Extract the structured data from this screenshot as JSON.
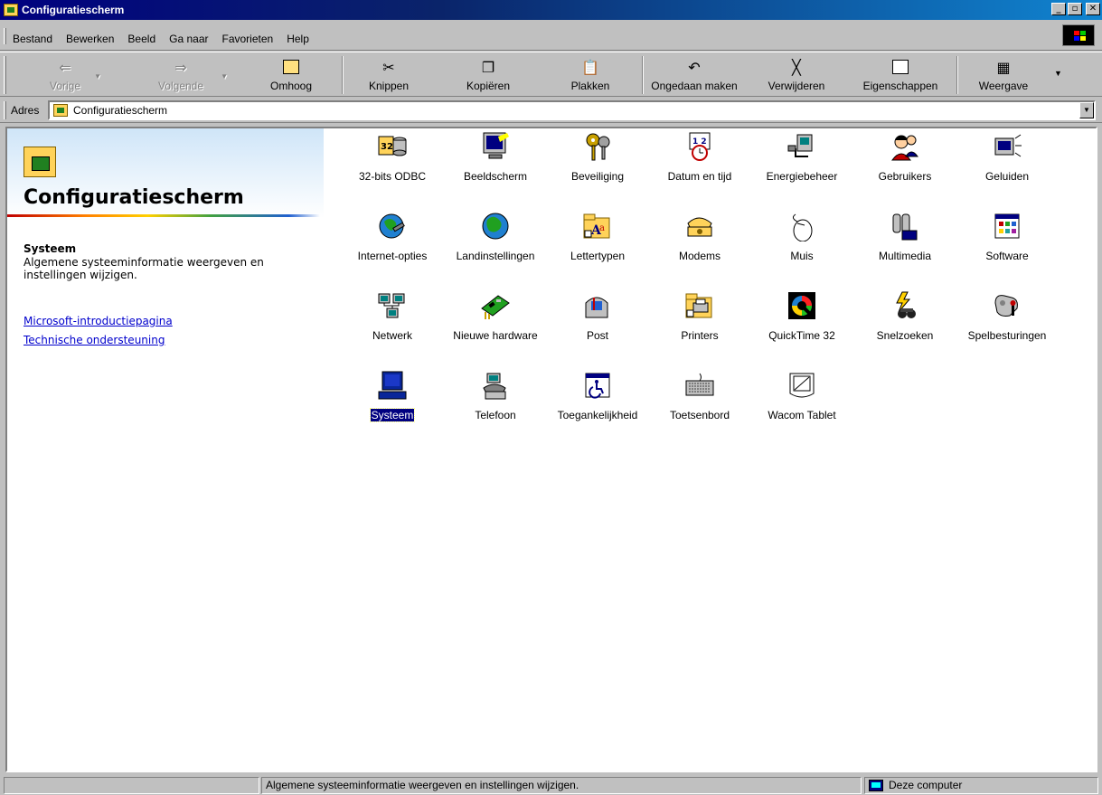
{
  "window": {
    "title": "Configuratiescherm"
  },
  "menu": [
    "Bestand",
    "Bewerken",
    "Beeld",
    "Ga naar",
    "Favorieten",
    "Help"
  ],
  "toolbar": {
    "back": "Vorige",
    "forward": "Volgende",
    "up": "Omhoog",
    "cut": "Knippen",
    "copy": "Kopiëren",
    "paste": "Plakken",
    "undo": "Ongedaan maken",
    "delete": "Verwijderen",
    "properties": "Eigenschappen",
    "views": "Weergave"
  },
  "address": {
    "label": "Adres",
    "value": "Configuratiescherm"
  },
  "left_pane": {
    "title": "Configuratiescherm",
    "selected_name": "Systeem",
    "selected_description": "Algemene systeeminformatie weergeven en instellingen wijzigen.",
    "links": [
      "Microsoft-introductiepagina",
      "Technische ondersteuning"
    ]
  },
  "items": [
    "32-bits ODBC",
    "Beeldscherm",
    "Beveiliging",
    "Datum en tijd",
    "Energiebeheer",
    "Gebruikers",
    "Geluiden",
    "Internet-opties",
    "Landinstellingen",
    "Lettertypen",
    "Modems",
    "Muis",
    "Multimedia",
    "Software",
    "Netwerk",
    "Nieuwe hardware",
    "Post",
    "Printers",
    "QuickTime 32",
    "Snelzoeken",
    "Spelbesturingen",
    "Systeem",
    "Telefoon",
    "Toegankelijkheid",
    "Toetsenbord",
    "Wacom Tablet"
  ],
  "selected_item": "Systeem",
  "status": {
    "pane1": "",
    "pane2": "Algemene systeeminformatie weergeven en instellingen wijzigen.",
    "pane3": "Deze computer"
  }
}
